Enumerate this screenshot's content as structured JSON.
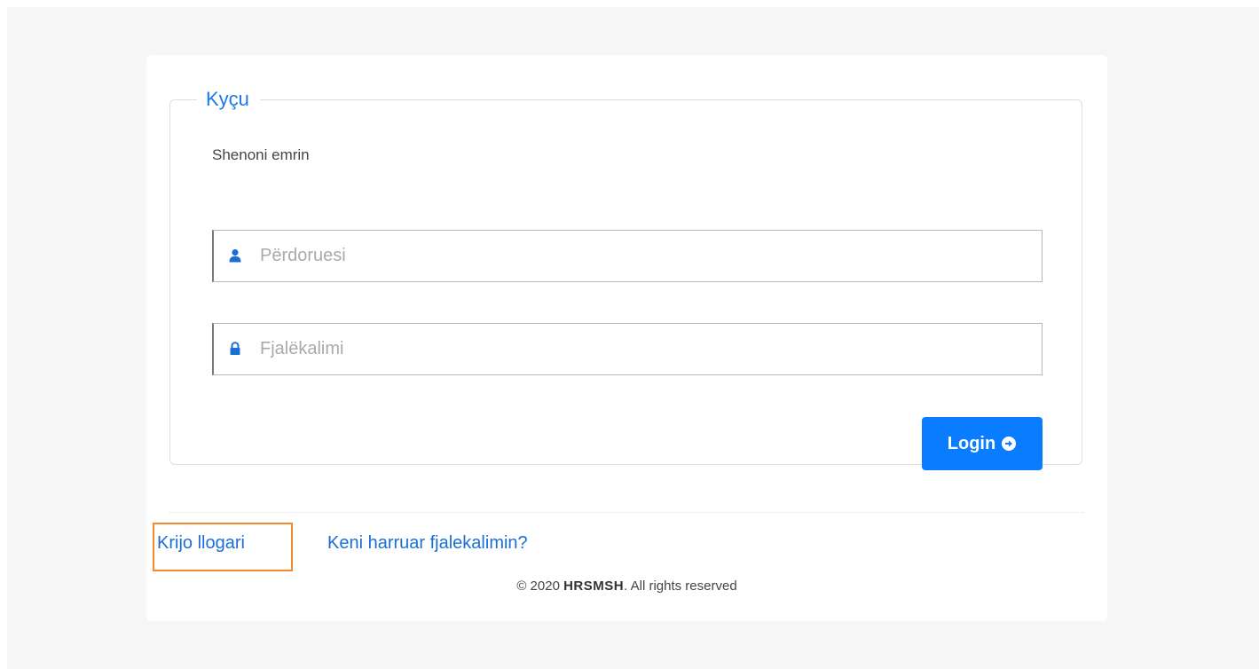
{
  "login": {
    "legend": "Kyçu",
    "helper_label": "Shenoni emrin",
    "username": {
      "placeholder": "Përdoruesi",
      "value": "",
      "icon": "user-icon"
    },
    "password": {
      "placeholder": "Fjalëkalimi",
      "value": "",
      "icon": "lock-icon"
    },
    "submit_label": "Login",
    "submit_icon": "arrow-circle-right-icon"
  },
  "links": {
    "create_account": "Krijo llogari",
    "forgot_password": "Keni harruar fjalekalimin?"
  },
  "footer": {
    "prefix": "© 2020",
    "brand": "HRSMSH",
    "suffix": ". All rights reserved"
  },
  "colors": {
    "accent": "#0a7cff",
    "legend": "#1a7ae8",
    "highlight": "#f08a2c",
    "background": "#f6f6f6"
  }
}
